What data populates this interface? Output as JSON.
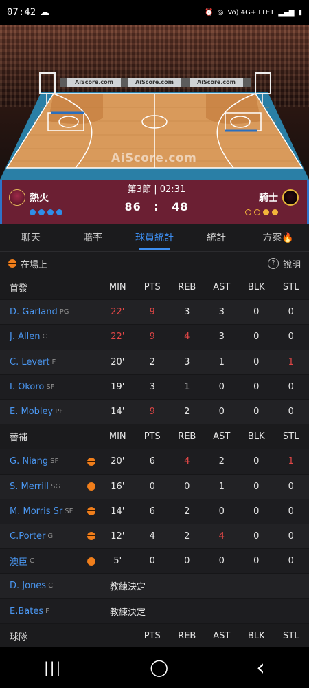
{
  "status_bar": {
    "time": "07:42",
    "network": "Vo) 4G+ LTE1"
  },
  "court": {
    "ads": [
      "AiScore.com",
      "AiScore.com",
      "AiScore.com"
    ],
    "watermark": "AiScore.com"
  },
  "match": {
    "period": "第3節 | 02:31",
    "home": {
      "name": "熱火",
      "score": "86"
    },
    "away": {
      "name": "騎士",
      "score": "48"
    },
    "separator": ":"
  },
  "tabs": [
    "聊天",
    "賠率",
    "球員統計",
    "統計",
    "方案🔥"
  ],
  "active_tab": 2,
  "subheader": {
    "on_court": "在場上",
    "help": "說明"
  },
  "starters": {
    "label": "首發",
    "columns": [
      "MIN",
      "PTS",
      "REB",
      "AST",
      "BLK",
      "STL"
    ],
    "players": [
      {
        "name": "D. Garland",
        "pos": "PG",
        "stats": [
          "22'",
          "9",
          "3",
          "3",
          "0",
          "0"
        ],
        "red": [
          0,
          1
        ]
      },
      {
        "name": "J. Allen",
        "pos": "C",
        "stats": [
          "22'",
          "9",
          "4",
          "3",
          "0",
          "0"
        ],
        "red": [
          0,
          1,
          2
        ]
      },
      {
        "name": "C. Levert",
        "pos": "F",
        "stats": [
          "20'",
          "2",
          "3",
          "1",
          "0",
          "1"
        ],
        "red": [
          5
        ]
      },
      {
        "name": "I. Okoro",
        "pos": "SF",
        "stats": [
          "19'",
          "3",
          "1",
          "0",
          "0",
          "0"
        ],
        "red": []
      },
      {
        "name": "E. Mobley",
        "pos": "PF",
        "stats": [
          "14'",
          "9",
          "2",
          "0",
          "0",
          "0"
        ],
        "red": [
          1
        ]
      }
    ]
  },
  "bench": {
    "label": "替補",
    "columns": [
      "MIN",
      "PTS",
      "REB",
      "AST",
      "BLK",
      "STL"
    ],
    "players": [
      {
        "name": "G. Niang",
        "pos": "SF",
        "ball": true,
        "stats": [
          "20'",
          "6",
          "4",
          "2",
          "0",
          "1"
        ],
        "red": [
          2,
          5
        ]
      },
      {
        "name": "S. Merrill",
        "pos": "SG",
        "ball": true,
        "stats": [
          "16'",
          "0",
          "0",
          "1",
          "0",
          "0"
        ],
        "red": []
      },
      {
        "name": "M. Morris Sr",
        "pos": "SF",
        "ball": true,
        "stats": [
          "14'",
          "6",
          "2",
          "0",
          "0",
          "0"
        ],
        "red": []
      },
      {
        "name": "C.Porter",
        "pos": "G",
        "ball": true,
        "stats": [
          "12'",
          "4",
          "2",
          "4",
          "0",
          "0"
        ],
        "red": [
          3
        ]
      },
      {
        "name": "澳臣",
        "pos": "C",
        "ball": true,
        "stats": [
          "5'",
          "0",
          "0",
          "0",
          "0",
          "0"
        ],
        "red": []
      },
      {
        "name": "D. Jones",
        "pos": "C",
        "note": "教練決定"
      },
      {
        "name": "E.Bates",
        "pos": "F",
        "note": "教練決定"
      }
    ]
  },
  "team_row": {
    "label": "球隊",
    "columns": [
      "",
      "PTS",
      "REB",
      "AST",
      "BLK",
      "STL"
    ]
  },
  "navbar": {
    "recent": "|||",
    "home": "◯",
    "back": "‹"
  }
}
